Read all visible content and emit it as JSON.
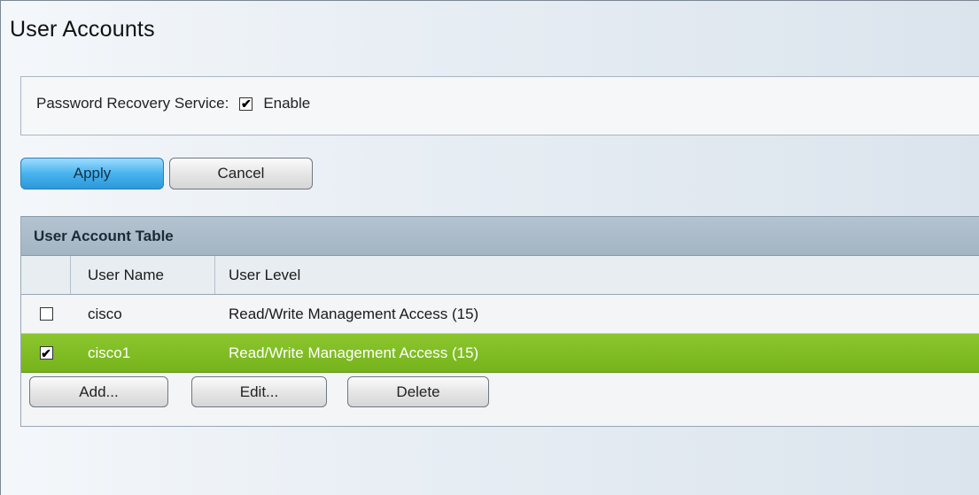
{
  "page": {
    "title": "User Accounts"
  },
  "settings": {
    "password_recovery_label": "Password Recovery Service:",
    "password_recovery_checked": true,
    "enable_label": "Enable"
  },
  "actions": {
    "apply_label": "Apply",
    "cancel_label": "Cancel"
  },
  "table": {
    "caption": "User Account Table",
    "columns": [
      "User Name",
      "User Level"
    ],
    "rows": [
      {
        "checked": false,
        "user_name": "cisco",
        "user_level": "Read/Write Management Access (15)",
        "selected": false
      },
      {
        "checked": true,
        "user_name": "cisco1",
        "user_level": "Read/Write Management Access (15)",
        "selected": true
      }
    ],
    "buttons": {
      "add_label": "Add...",
      "edit_label": "Edit...",
      "delete_label": "Delete"
    }
  },
  "colors": {
    "selected_row": "#80bd24",
    "primary_button": "#48b3ee",
    "table_header": "#a9b9c8"
  },
  "icons": {
    "checked": "checkmark-icon"
  }
}
